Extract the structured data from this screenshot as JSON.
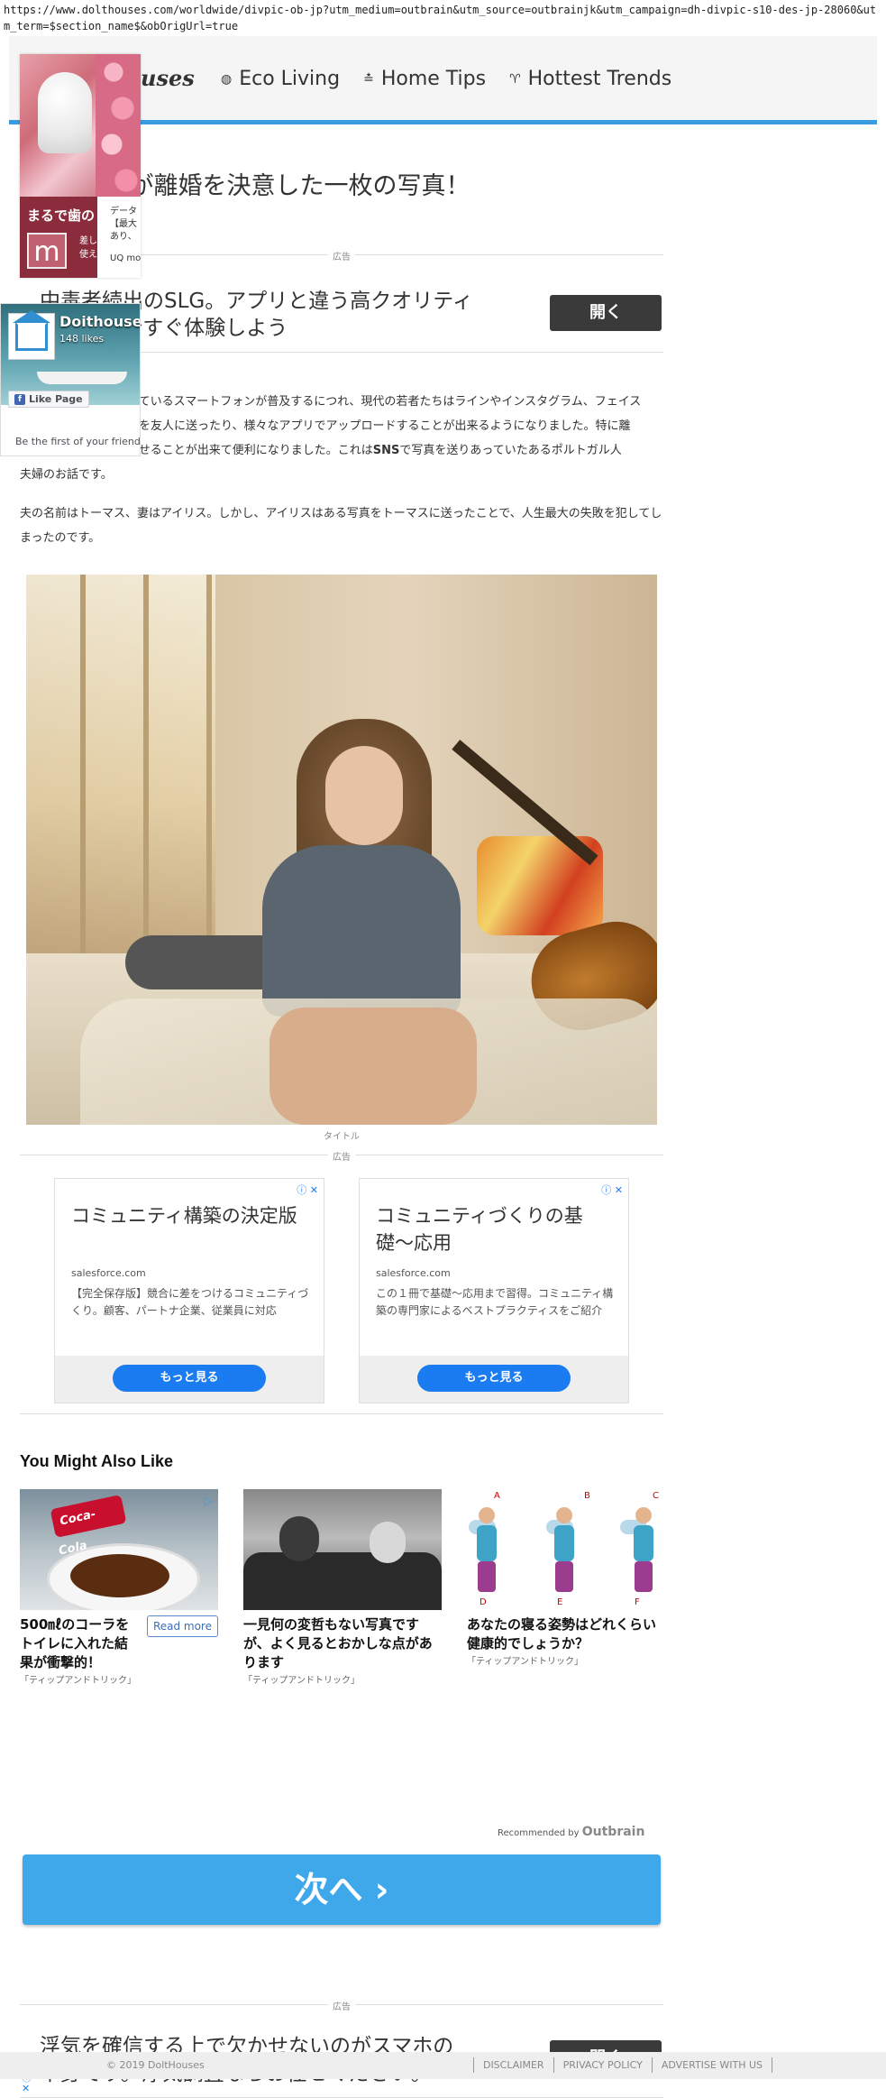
{
  "url": "https://www.dolthouses.com/worldwide/divpic-ob-jp?utm_medium=outbrain&utm_source=outbrainjk&utm_campaign=dh-divpic-s10-des-jp-28060&utm_term=$section_name$&obOrigUrl=true",
  "header": {
    "logo": "ouses",
    "nav": [
      {
        "icon": "globe-icon",
        "glyph": "◍",
        "label": "Eco Living"
      },
      {
        "icon": "home-tips-icon",
        "glyph": "≛",
        "label": "Home Tips"
      },
      {
        "icon": "trophy-icon",
        "glyph": "♈",
        "label": "Hottest Trends"
      }
    ]
  },
  "popup_ad": {
    "headline": "まるで歯の",
    "side_text": [
      "データ",
      "【最大",
      "あり、"
    ],
    "bottom_text": [
      "差し",
      "使え"
    ],
    "advertiser": "UQ mo",
    "letter": "m"
  },
  "facebook": {
    "page_name": "Doithouses",
    "likes": "148 likes",
    "like_button": "Like Page",
    "first_friends": "Be the first of your friends"
  },
  "article": {
    "title": "見て･･･夫が離婚を決意した一枚の写真！",
    "ad_label": "広告",
    "top_banner_ad": {
      "text_line1": "中毒者続出のSLG。アプリと違う高クオリティ",
      "text_line2": "ゲームを今すぐ体験しよう",
      "button": "開く"
    },
    "paragraph1": "能が付いているスマートフォンが普及するにつれ、現代の若者たちはラインやインスタグラム、フェイス",
    "paragraph1_l2": "った写真を友人に送ったり、様々なアプリでアップロードすることが出来るようになりました。特に離",
    "paragraph1_l3a": "況を知らせることが出来て便利になりました。これは",
    "paragraph1_bold": "SNS",
    "paragraph1_l3b": "で写真を送りあっていたあるポルトガル人",
    "paragraph1_l4": "夫婦のお話です。",
    "paragraph2": "夫の名前はトーマス、妻はアイリス。しかし、アイリスはある写真をトーマスに送ったことで、人生最大の失敗を犯してしまったのです。",
    "photo_caption": "タイトル"
  },
  "native_ads": [
    {
      "headline": "コミュニティ構築の決定版",
      "domain": "salesforce.com",
      "description": "【完全保存版】競合に差をつけるコミュニティづくり。顧客、パートナ企業、従業員に対応",
      "button": "もっと見る",
      "adchoices": "ⓘ ✕"
    },
    {
      "headline": "コミュニティづくりの基礎〜応用",
      "domain": "salesforce.com",
      "description": "この１冊で基礎〜応用まで習得。コミュニティ構築の専門家によるベストプラクティスをご紹介",
      "button": "もっと見る",
      "adchoices": "ⓘ ✕"
    }
  ],
  "recommendations": {
    "heading": "You Might Also Like",
    "items": [
      {
        "title": "500㎖のコーラをトイレに入れた結果が衝撃的！",
        "source": "「ティップアンドトリック」",
        "read_more": "Read more",
        "can_text": "Coca-Cola"
      },
      {
        "title": "一見何の変哲もない写真ですが、よく見るとおかしな点があります",
        "source": "「ティップアンドトリック」"
      },
      {
        "title": "あなたの寝る姿勢はどれくらい健康的でしょうか？",
        "source": "「ティップアンドトリック」",
        "letters": [
          "A",
          "B",
          "C",
          "D",
          "E",
          "F"
        ]
      }
    ],
    "recommended_by": "Recommended by",
    "brand": "Outbrain"
  },
  "next_button": "次へ ›",
  "bottom_banner_ad": {
    "text_line1": "浮気を確信する上で欠かせないのがスマホの",
    "text_line2": "中身です。浮気調査ならお任せください。",
    "button": "開く"
  },
  "footer": {
    "copyright": "© 2019 DoltHouses",
    "links": [
      "DISCLAIMER",
      "PRIVACY POLICY",
      "ADVERTISE WITH US"
    ]
  },
  "colors": {
    "accent_blue": "#3a9ce0",
    "next_button": "#3fa8ea",
    "ad_button": "#3a3a3a",
    "cta_blue": "#1a7cf0"
  }
}
